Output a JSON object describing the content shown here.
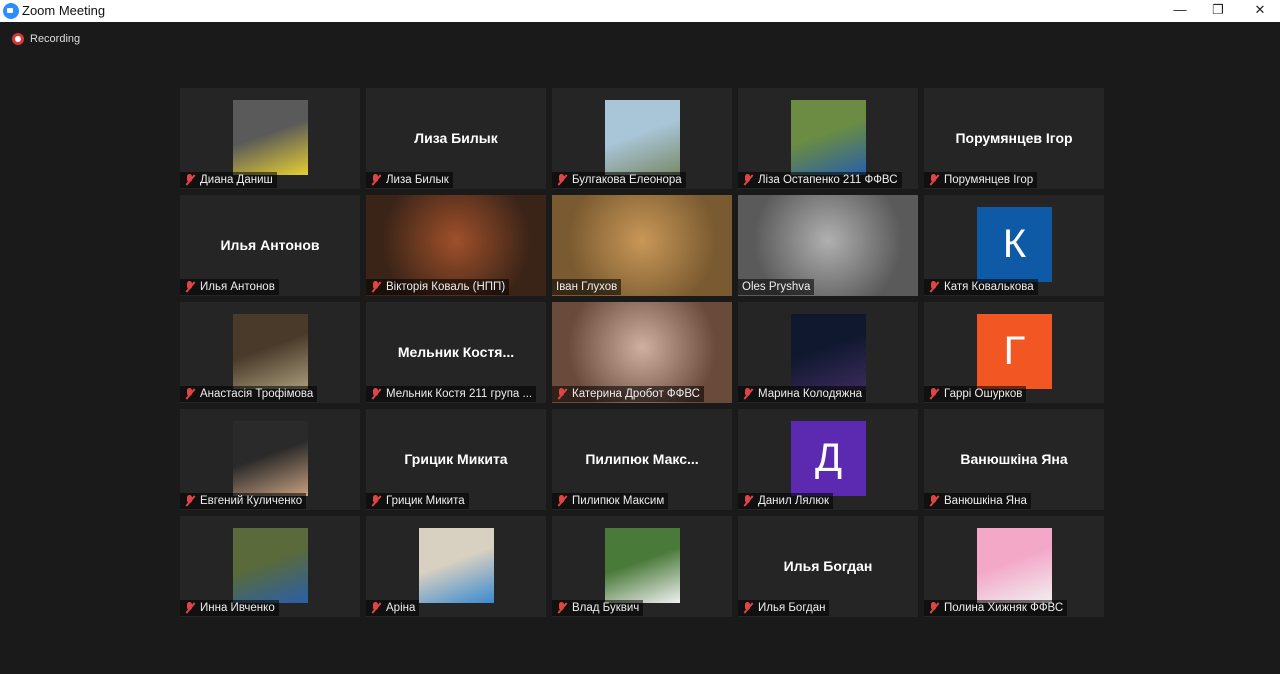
{
  "window": {
    "title": "Zoom Meeting",
    "minimize": "—",
    "restore": "❐",
    "close": "✕"
  },
  "recording": {
    "label": "Recording"
  },
  "tiles": [
    {
      "name": "Диана Даниш",
      "type": "image",
      "muted": true,
      "colors": [
        "#5a5a5a",
        "#e6d032"
      ]
    },
    {
      "name": "Лиза Билык",
      "type": "text",
      "muted": true
    },
    {
      "name": "Булгакова Елеонора",
      "type": "image",
      "muted": true,
      "colors": [
        "#a9c5d8",
        "#7a8a6a"
      ]
    },
    {
      "name": "Ліза Остапенко 211 ФФВС",
      "type": "image",
      "muted": true,
      "colors": [
        "#6b8c42",
        "#2a5fa8"
      ]
    },
    {
      "name": "Порумянцев Ігор",
      "type": "text",
      "muted": true
    },
    {
      "name": "Илья Антонов",
      "type": "text",
      "muted": true
    },
    {
      "name": "Вікторія Коваль (НПП)",
      "type": "video",
      "muted": true,
      "colors": [
        "#3a2418",
        "#a0502a"
      ]
    },
    {
      "name": "Іван Глухов",
      "type": "video",
      "muted": false,
      "highlight": true,
      "colors": [
        "#7a5a30",
        "#c89858"
      ]
    },
    {
      "name": "Oles Pryshva",
      "type": "video",
      "muted": false,
      "colors": [
        "#5a5a5a",
        "#b0b0b0"
      ]
    },
    {
      "name": "Катя Ковалькова",
      "type": "avatar",
      "muted": true,
      "initial": "К",
      "avatar_color": "#0e5aa7"
    },
    {
      "name": "Анастасія Трофімова",
      "type": "image",
      "muted": true,
      "colors": [
        "#4a3a2a",
        "#a89a7a"
      ]
    },
    {
      "name": "Мельник Костя 211 група ...",
      "type": "text",
      "muted": true,
      "center_label": "Мельник  Костя..."
    },
    {
      "name": "Катерина Дробот ФФВС",
      "type": "video",
      "muted": true,
      "colors": [
        "#6a4a3a",
        "#d0b0a0"
      ]
    },
    {
      "name": "Марина Колодяжна",
      "type": "image",
      "muted": true,
      "colors": [
        "#101830",
        "#3a2a5a"
      ]
    },
    {
      "name": "Гаррі Ошурков",
      "type": "avatar",
      "muted": true,
      "initial": "Г",
      "avatar_color": "#f15623"
    },
    {
      "name": "Евгений Куличенко",
      "type": "image",
      "muted": true,
      "colors": [
        "#2a2a2a",
        "#c8a080"
      ]
    },
    {
      "name": "Грицик Микита",
      "type": "text",
      "muted": true
    },
    {
      "name": "Пилипюк Максим",
      "type": "text",
      "muted": true,
      "center_label": "Пилипюк  Макс..."
    },
    {
      "name": "Данил Лялюк",
      "type": "avatar",
      "muted": true,
      "initial": "Д",
      "avatar_color": "#5b2ab0"
    },
    {
      "name": "Ванюшкіна Яна",
      "type": "text",
      "muted": true
    },
    {
      "name": "Инна Ивченко",
      "type": "image",
      "muted": true,
      "colors": [
        "#5a6a3a",
        "#2a5fa8"
      ]
    },
    {
      "name": "Аріна",
      "type": "image",
      "muted": true,
      "colors": [
        "#d8d0c0",
        "#3a8ad0"
      ]
    },
    {
      "name": "Влад Буквич",
      "type": "image",
      "muted": true,
      "colors": [
        "#4a7a3a",
        "#f0f0f0"
      ]
    },
    {
      "name": "Илья Богдан",
      "type": "text",
      "muted": true
    },
    {
      "name": "Полина Хижняк ФФВС",
      "type": "image",
      "muted": true,
      "colors": [
        "#f4a8c8",
        "#f0f0f0"
      ]
    }
  ]
}
